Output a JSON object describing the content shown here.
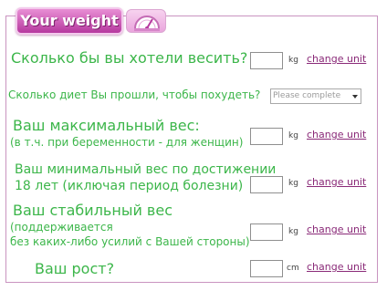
{
  "header": {
    "title": "Your weight",
    "icon": "scale-icon"
  },
  "questions": {
    "desired_weight": {
      "label": "Сколько бы вы хотели весить?",
      "unit": "kg",
      "link": "change unit"
    },
    "diets_count": {
      "label": "Сколько диет  Вы прошли, чтобы похудеть?",
      "select_value": "Please complete"
    },
    "max_weight": {
      "label_line1": "Ваш максимальный вес:",
      "label_line2": "(в т.ч. при беременности - для женщин)",
      "unit": "kg",
      "link": "change unit"
    },
    "min_weight": {
      "label_line1": "Ваш минимальный вес по достижении",
      "label_line2": "18 лет (иключая период болезни)",
      "unit": "kg",
      "link": "change unit"
    },
    "stable_weight": {
      "label_line1": "Ваш стабильный вес",
      "label_line2": "(поддерживается",
      "label_line3": "без каких-либо усилий с Вашей стороны)",
      "unit": "kg",
      "link": "change unit"
    },
    "height": {
      "label": "Ваш рост?",
      "unit": "cm",
      "link": "change unit"
    }
  },
  "colors": {
    "question_text": "#3cb64a",
    "link": "#8a2a78",
    "tab": "#b6399f",
    "border": "#c993c0"
  }
}
